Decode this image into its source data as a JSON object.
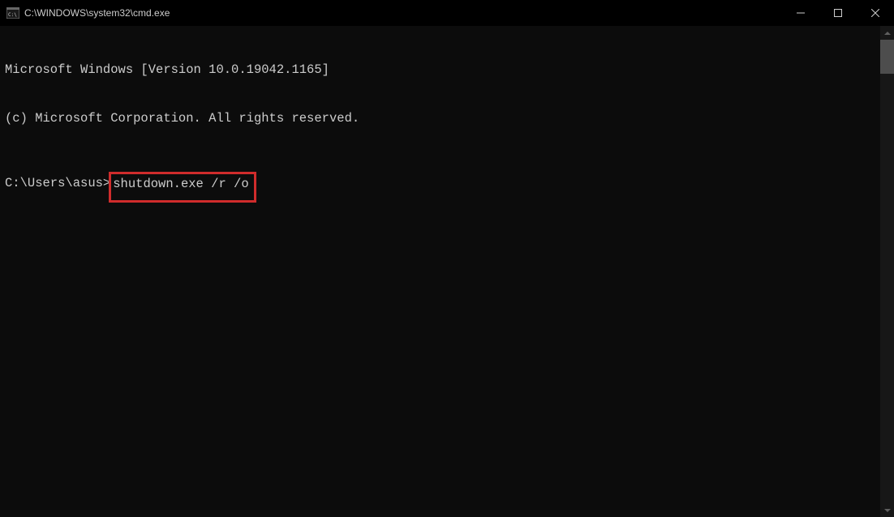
{
  "titlebar": {
    "title": "C:\\WINDOWS\\system32\\cmd.exe"
  },
  "terminal": {
    "line1": "Microsoft Windows [Version 10.0.19042.1165]",
    "line2": "(c) Microsoft Corporation. All rights reserved.",
    "prompt_prefix": "C:\\Users\\asus>",
    "command": "shutdown.exe /r /o"
  }
}
